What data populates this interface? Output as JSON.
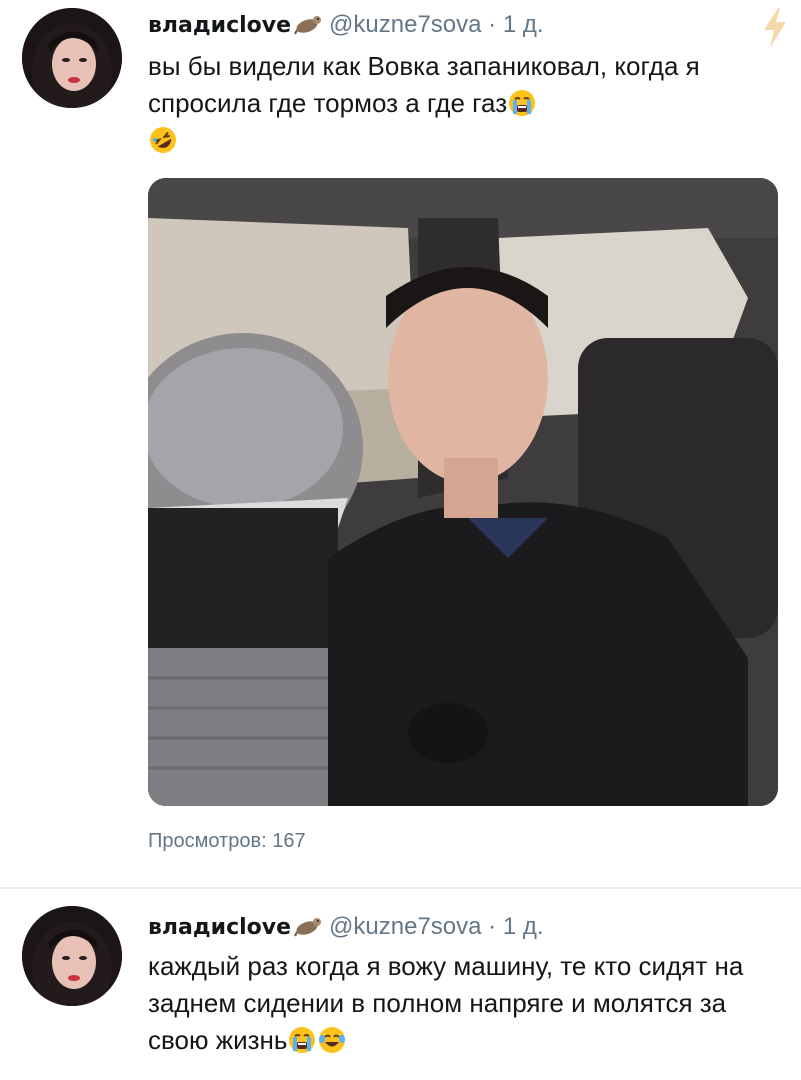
{
  "tweets": [
    {
      "author_name": "владиclove",
      "handle": "@kuzne7sova",
      "separator": "·",
      "time": "1 д.",
      "text": "вы бы видели как Вовка запаниковал, когда я спросила где тормоз а где газ",
      "emojis": [
        "crying-face-emoji",
        "rolling-laughing-emoji"
      ],
      "has_video": true,
      "views_label": "Просмотров: 167"
    },
    {
      "author_name": "владиclove",
      "handle": "@kuzne7sova",
      "separator": "·",
      "time": "1 д.",
      "text": "каждый раз когда я вожу машину, те кто сидят на заднем сидении в полном напряге и молятся за свою жизнь",
      "emojis": [
        "crying-face-emoji",
        "tears-of-joy-emoji"
      ]
    }
  ],
  "icons": {
    "badge": "otter-icon",
    "top_right": "lightning-bolt-icon"
  },
  "colors": {
    "meta_text": "#657786",
    "divider": "#e6ecf0",
    "bolt": "#f5d9a8"
  }
}
